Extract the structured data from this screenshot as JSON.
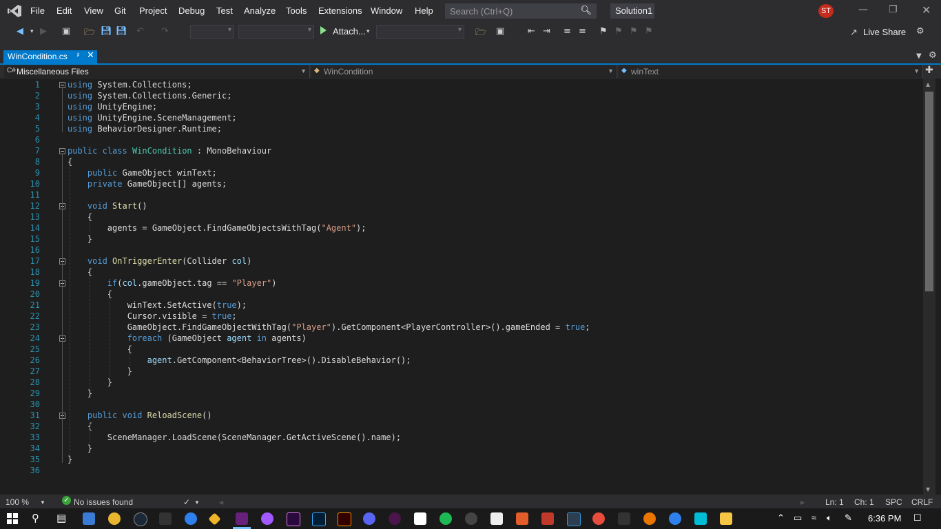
{
  "menu": [
    "File",
    "Edit",
    "View",
    "Git",
    "Project",
    "Debug",
    "Test",
    "Analyze",
    "Tools",
    "Extensions",
    "Window",
    "Help"
  ],
  "search": {
    "placeholder": "Search (Ctrl+Q)"
  },
  "solution_name": "Solution1",
  "user_initials": "ST",
  "toolbar": {
    "attach_label": "Attach...",
    "live_share_label": "Live Share"
  },
  "tab": {
    "title": "WinCondition.cs"
  },
  "navbar": {
    "project": "Miscellaneous Files",
    "class": "WinCondition",
    "member": "winText"
  },
  "code": {
    "line_numbers": [
      "1",
      "2",
      "3",
      "4",
      "5",
      "6",
      "7",
      "8",
      "9",
      "10",
      "11",
      "12",
      "13",
      "14",
      "15",
      "16",
      "17",
      "18",
      "19",
      "20",
      "21",
      "22",
      "23",
      "24",
      "25",
      "26",
      "27",
      "28",
      "29",
      "30",
      "31",
      "32",
      "33",
      "34",
      "35",
      "36"
    ],
    "lines": [
      "using System.Collections;",
      "using System.Collections.Generic;",
      "using UnityEngine;",
      "using UnityEngine.SceneManagement;",
      "using BehaviorDesigner.Runtime;",
      "",
      "public class WinCondition : MonoBehaviour",
      "{",
      "    public GameObject winText;",
      "    private GameObject[] agents;",
      "",
      "    void Start()",
      "    {",
      "        agents = GameObject.FindGameObjectsWithTag(\"Agent\");",
      "    }",
      "",
      "    void OnTriggerEnter(Collider col)",
      "    {",
      "        if(col.gameObject.tag == \"Player\")",
      "        {",
      "            winText.SetActive(true);",
      "            Cursor.visible = true;",
      "            GameObject.FindGameObjectWithTag(\"Player\").GetComponent<PlayerController>().gameEnded = true;",
      "            foreach (GameObject agent in agents)",
      "            {",
      "                agent.GetComponent<BehaviorTree>().DisableBehavior();",
      "            }",
      "        }",
      "    }",
      "",
      "    public void ReloadScene()",
      "    {",
      "        SceneManager.LoadScene(SceneManager.GetActiveScene().name);",
      "    }",
      "}",
      ""
    ]
  },
  "status": {
    "zoom": "100 %",
    "issues": "No issues found",
    "line": "Ln: 1",
    "col": "Ch: 1",
    "spacing": "SPC",
    "eol": "CRLF"
  },
  "taskbar": {
    "time": "6:36 PM"
  },
  "colors": {
    "accent": "#007acc",
    "keyword": "#569cd6",
    "type": "#4ec9b0",
    "string": "#d69d85",
    "method": "#dcdcaa",
    "variable": "#9cdcfe",
    "line_number": "#2b91af"
  }
}
